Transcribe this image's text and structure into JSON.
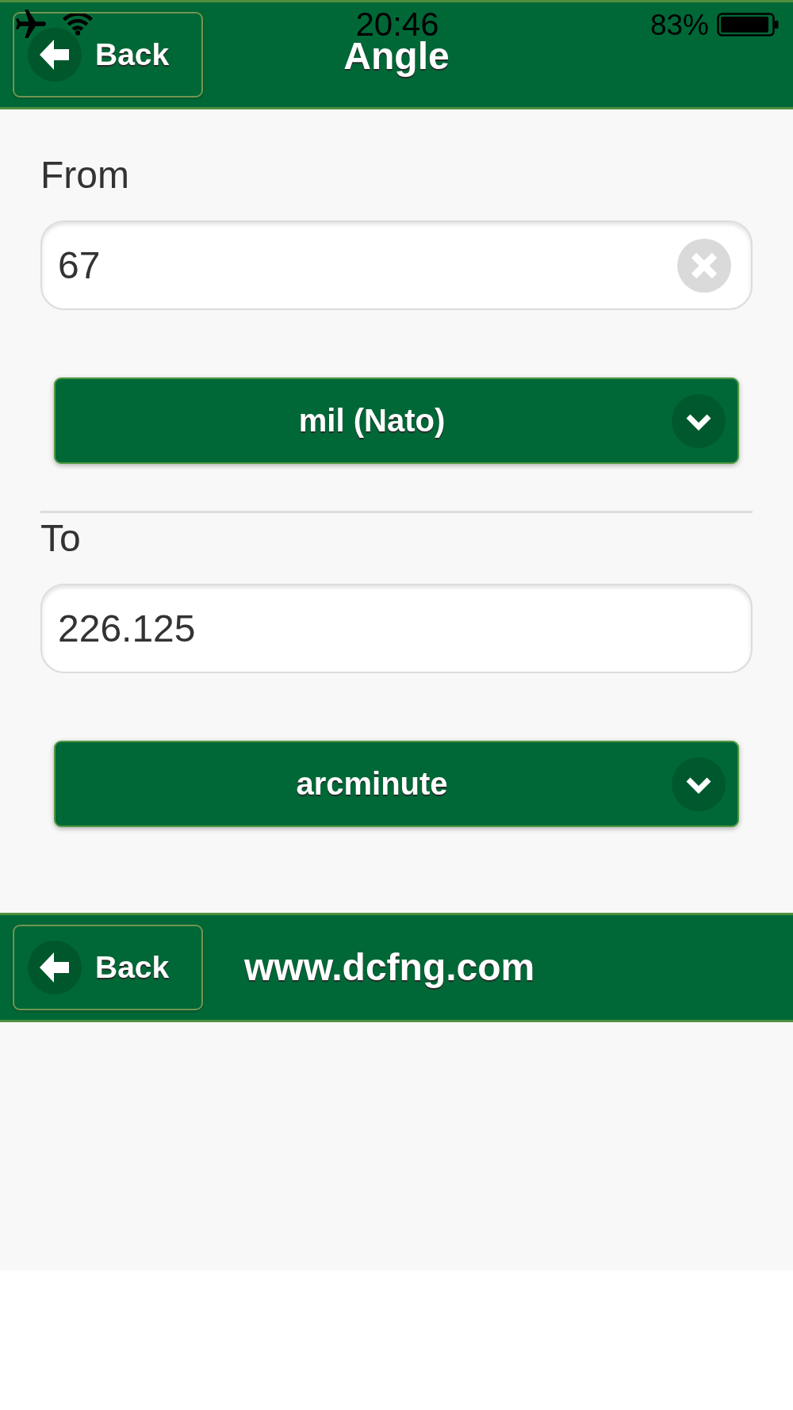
{
  "status_bar": {
    "time": "20:46",
    "battery": "83%"
  },
  "header": {
    "back_button": "Back",
    "title": "Angle"
  },
  "fields": [
    {
      "label": "From",
      "value": "67",
      "clear_button": true,
      "unit": "mil (Nato)"
    },
    {
      "label": "To",
      "value": "226.125",
      "clear_button": false,
      "unit": "arcminute"
    }
  ],
  "footer": {
    "back_button": "Back",
    "site": "www.dcfng.com"
  }
}
